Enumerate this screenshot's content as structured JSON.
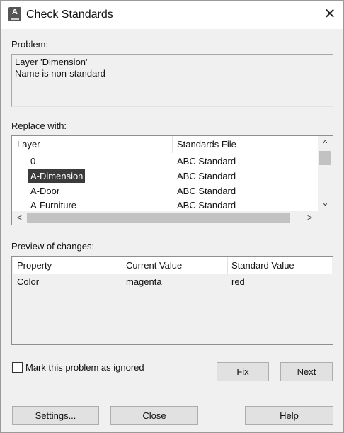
{
  "dialog": {
    "title": "Check Standards",
    "icon": "autocad-icon",
    "close_glyph": "✕"
  },
  "problem": {
    "label": "Problem:",
    "lines": [
      "Layer 'Dimension'",
      "Name is non-standard"
    ]
  },
  "replace": {
    "label": "Replace with:",
    "columns": [
      "Layer",
      "Standards File"
    ],
    "rows": [
      {
        "layer": "0",
        "file": "ABC Standard"
      },
      {
        "layer": "A-Dimension",
        "file": "ABC Standard",
        "selected": true
      },
      {
        "layer": "A-Door",
        "file": "ABC Standard"
      },
      {
        "layer": "A-Furniture",
        "file": "ABC Standard"
      }
    ],
    "scroll_up": "^",
    "scroll_down": "⌄",
    "scroll_left": "<",
    "scroll_right": ">"
  },
  "preview": {
    "label": "Preview of changes:",
    "columns": [
      "Property",
      "Current Value",
      "Standard Value"
    ],
    "rows": [
      {
        "property": "Color",
        "current": "magenta",
        "standard": "red"
      }
    ]
  },
  "ignore_checkbox": {
    "label": "Mark this problem as ignored",
    "checked": false
  },
  "buttons": {
    "fix": "Fix",
    "next": "Next",
    "settings": "Settings...",
    "close": "Close",
    "help": "Help"
  }
}
